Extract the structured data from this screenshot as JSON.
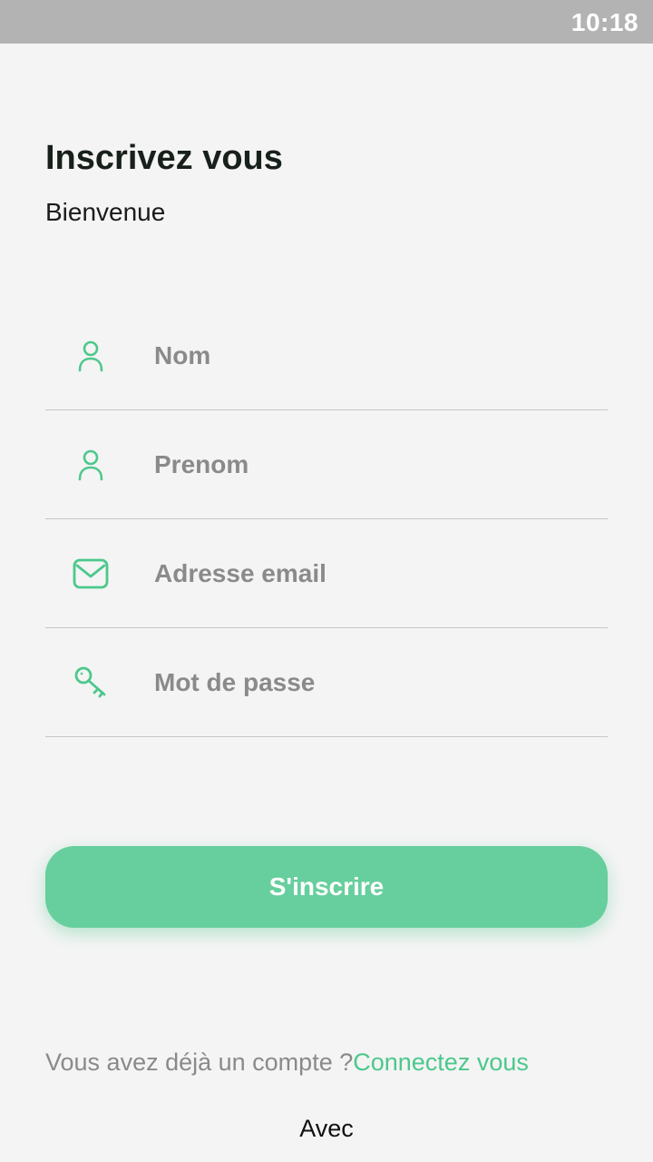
{
  "status_bar": {
    "time": "10:18"
  },
  "header": {
    "title": "Inscrivez vous",
    "subtitle": "Bienvenue"
  },
  "form": {
    "fields": [
      {
        "icon": "person-icon",
        "placeholder": "Nom",
        "value": ""
      },
      {
        "icon": "person-icon",
        "placeholder": "Prenom",
        "value": ""
      },
      {
        "icon": "mail-icon",
        "placeholder": "Adresse email",
        "value": ""
      },
      {
        "icon": "key-icon",
        "placeholder": "Mot de passe",
        "value": ""
      }
    ],
    "submit_label": "S'inscrire"
  },
  "footer": {
    "question": "Vous avez déjà un compte ?",
    "login_link": "Connectez vous",
    "with_label": "Avec"
  },
  "colors": {
    "accent": "#66cf9d",
    "icon": "#4cc88c",
    "status_bar": "#b3b3b3",
    "background": "#f4f4f4"
  }
}
